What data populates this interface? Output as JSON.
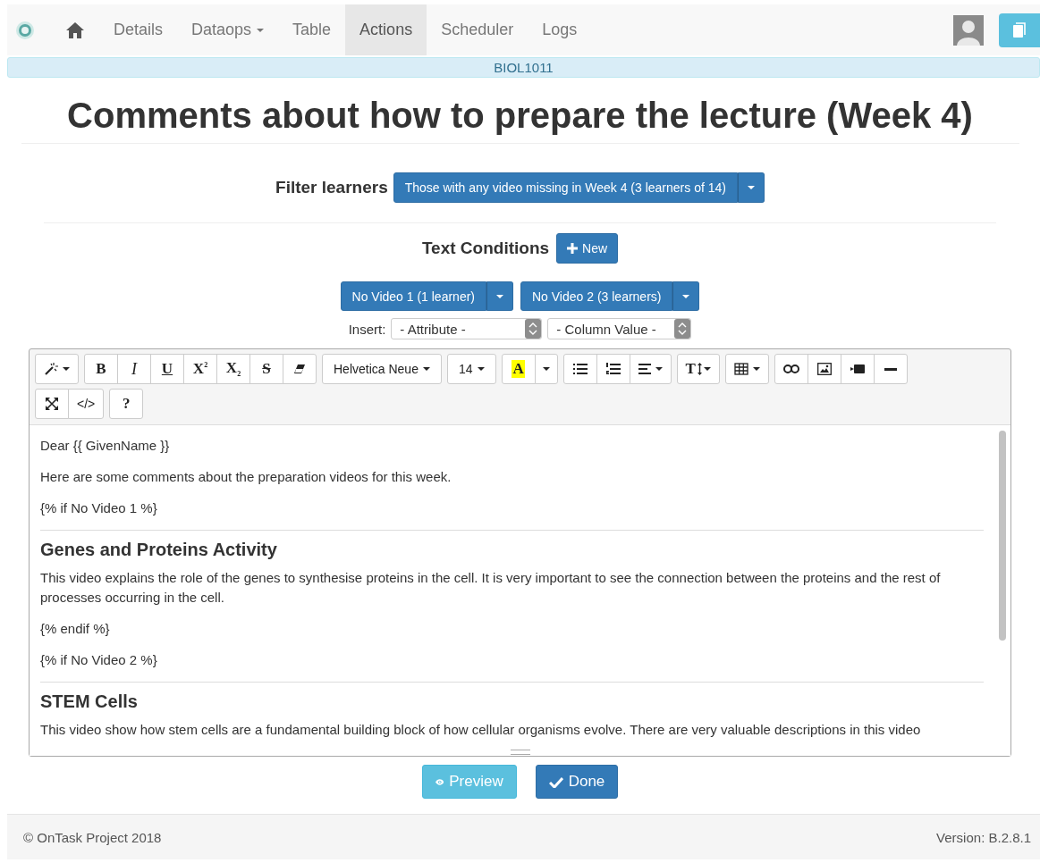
{
  "navbar": {
    "items": [
      {
        "kind": "link",
        "label": "Details",
        "selected": false
      },
      {
        "kind": "dropdown",
        "label": "Dataops",
        "selected": false
      },
      {
        "kind": "link",
        "label": "Table",
        "selected": false
      },
      {
        "kind": "link",
        "label": "Actions",
        "selected": true
      },
      {
        "kind": "link",
        "label": "Scheduler",
        "selected": false
      },
      {
        "kind": "link",
        "label": "Logs",
        "selected": false
      }
    ]
  },
  "workflow_bar": {
    "label": "BIOL1011"
  },
  "title": "Comments about how to prepare the lecture (Week 4)",
  "filter": {
    "label": "Filter learners",
    "button": "Those with any video missing in Week 4 (3 learners of 14)"
  },
  "text_conditions": {
    "label": "Text Conditions",
    "new_button": "New",
    "conditions": [
      {
        "label": "No Video 1 (1 learner)"
      },
      {
        "label": "No Video 2 (3 learners)"
      }
    ]
  },
  "insert": {
    "label": "Insert:",
    "selects": [
      {
        "value": "- Attribute -"
      },
      {
        "value": "- Column Value -"
      }
    ]
  },
  "editor": {
    "toolbar": [
      [
        [
          {
            "kind": "magic"
          }
        ],
        [
          {
            "kind": "bold",
            "label": "B"
          },
          {
            "kind": "italic",
            "label": "I"
          },
          {
            "kind": "underline",
            "label": "U"
          },
          {
            "kind": "bold",
            "label": "X$^{2}$"
          },
          {
            "kind": "bold",
            "label": "X$_{2}$"
          },
          {
            "kind": "strike",
            "label": "S"
          },
          {
            "kind": "eraser"
          }
        ],
        [
          {
            "kind": "font",
            "label": "Helvetica Neue"
          }
        ],
        [
          {
            "kind": "font",
            "label": "14"
          }
        ],
        [
          {
            "kind": "highlight",
            "label": "A"
          },
          {
            "kind": "caret"
          }
        ],
        [
          {
            "kind": "bullets"
          },
          {
            "kind": "numbers"
          },
          {
            "kind": "align"
          }
        ],
        [
          {
            "kind": "textheight",
            "label": "T"
          }
        ],
        [
          {
            "kind": "table"
          }
        ],
        [
          {
            "kind": "link"
          },
          {
            "kind": "image"
          },
          {
            "kind": "video"
          },
          {
            "kind": "rule"
          }
        ]
      ],
      [
        [
          {
            "kind": "fullscreen"
          },
          {
            "kind": "plain",
            "label": "</>"
          }
        ],
        [
          {
            "kind": "bold",
            "label": "?"
          }
        ]
      ]
    ],
    "content": [
      {
        "kind": "p",
        "text": "Dear {{ GivenName }}"
      },
      {
        "kind": "p",
        "text": "Here are some comments about the preparation videos for this week."
      },
      {
        "kind": "p",
        "text": "{% if No Video 1 %}"
      },
      {
        "kind": "hr"
      },
      {
        "kind": "h",
        "text": "Genes and Proteins Activity"
      },
      {
        "kind": "p",
        "text": "This video explains the role of the genes to synthesise proteins in the cell. It is very important to see the connection between the proteins and the rest of processes occurring in the cell."
      },
      {
        "kind": "p",
        "text": "{% endif %}"
      },
      {
        "kind": "p",
        "text": "{% if No Video 2 %}"
      },
      {
        "kind": "hr"
      },
      {
        "kind": "h",
        "text": "STEM Cells"
      },
      {
        "kind": "p",
        "text": "This video show how stem cells are a fundamental building block of how cellular organisms evolve. There are very valuable descriptions in this video"
      }
    ]
  },
  "buttons": [
    {
      "kind": "preview",
      "label": "Preview"
    },
    {
      "kind": "done",
      "label": "Done"
    }
  ],
  "footer": {
    "left": "© OnTask Project 2018",
    "right": "Version: B.2.8.1"
  }
}
